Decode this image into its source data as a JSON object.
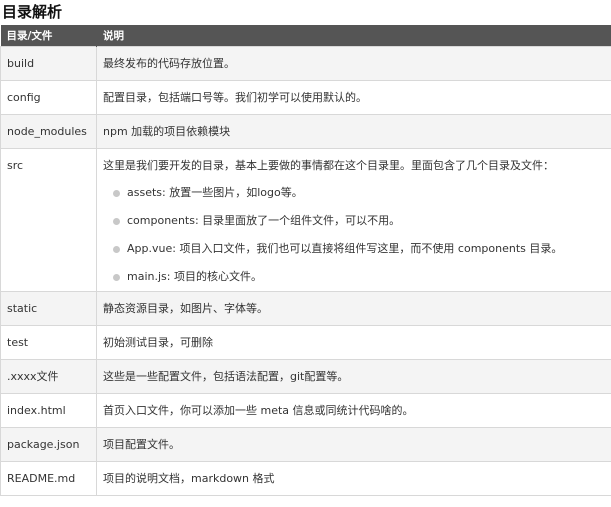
{
  "title": "目录解析",
  "headers": [
    "目录/文件",
    "说明"
  ],
  "rows": [
    {
      "name": "build",
      "desc": "最终发布的代码存放位置。"
    },
    {
      "name": "config",
      "desc": "配置目录，包括端口号等。我们初学可以使用默认的。"
    },
    {
      "name": "node_modules",
      "desc": "npm 加载的项目依赖模块"
    },
    {
      "name": "src",
      "desc": "这里是我们要开发的目录，基本上要做的事情都在这个目录里。里面包含了几个目录及文件："
    },
    {
      "name": "static",
      "desc": "静态资源目录，如图片、字体等。"
    },
    {
      "name": "test",
      "desc": "初始测试目录，可删除"
    },
    {
      "name": ".xxxx文件",
      "desc": "这些是一些配置文件，包括语法配置，git配置等。"
    },
    {
      "name": "index.html",
      "desc": "首页入口文件，你可以添加一些 meta 信息或同统计代码啥的。"
    },
    {
      "name": "package.json",
      "desc": "项目配置文件。"
    },
    {
      "name": "README.md",
      "desc": "项目的说明文档，markdown 格式"
    }
  ],
  "src_items": [
    "assets: 放置一些图片，如logo等。",
    "components: 目录里面放了一个组件文件，可以不用。",
    "App.vue: 项目入口文件，我们也可以直接将组件写这里，而不使用 components 目录。",
    "main.js: 项目的核心文件。"
  ]
}
